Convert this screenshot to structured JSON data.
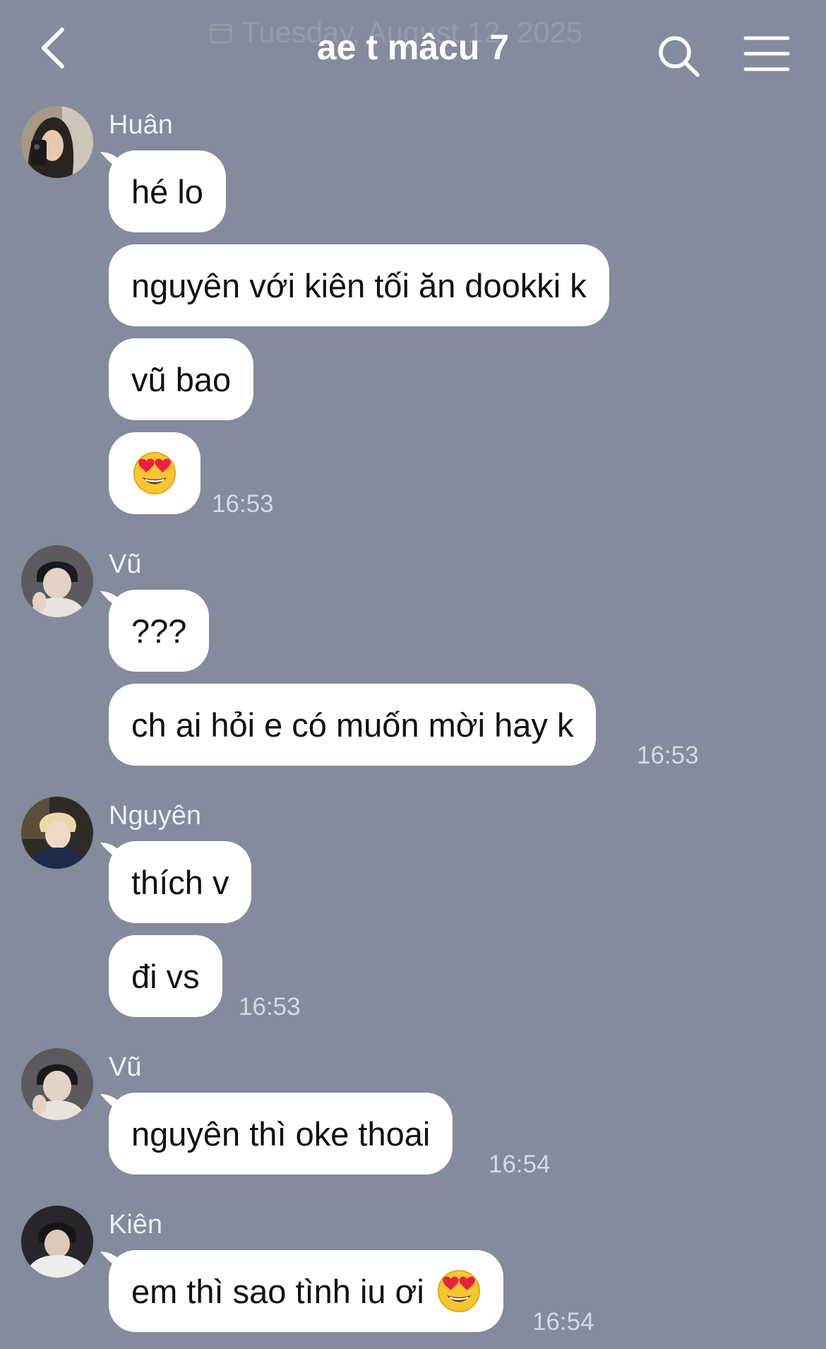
{
  "header": {
    "title": "ae t mâcu 7",
    "date_overlay": "Tuesday, August 12, 2025"
  },
  "messages": [
    {
      "sender": "Huân",
      "text": "hé lo"
    },
    {
      "text": "nguyên với kiên tối ăn dookki k"
    },
    {
      "text": "vũ bao"
    },
    {
      "emoji": "heart-eyes-emoji",
      "time": "16:53"
    },
    {
      "sender": "Vũ",
      "text": "???"
    },
    {
      "text": "ch ai hỏi e có muốn mời hay k",
      "time": "16:53"
    },
    {
      "sender": "Nguyên",
      "text": "thích v"
    },
    {
      "text": "đi vs",
      "time": "16:53"
    },
    {
      "sender": "Vũ",
      "text": "nguyên thì oke thoai",
      "time": "16:54"
    },
    {
      "sender": "Kiên",
      "text": "em thì sao tình iu ơi",
      "emoji": "heart-eyes-emoji",
      "time": "16:54"
    }
  ],
  "colors": {
    "background": "#838b9d",
    "bubble": "#ffffff",
    "text": "#111111"
  }
}
